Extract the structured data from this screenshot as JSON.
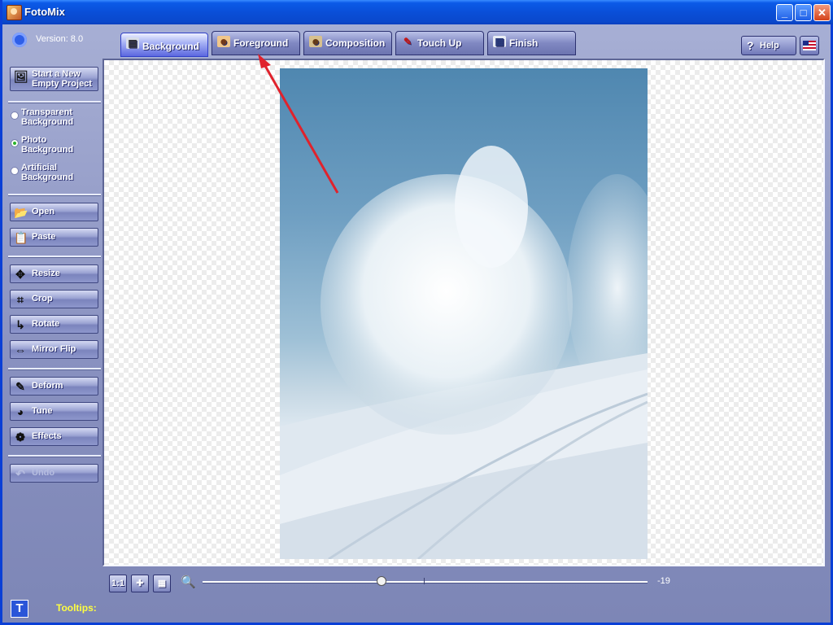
{
  "window": {
    "title": "FotoMix",
    "controls": {
      "minimize": "_",
      "maximize": "□",
      "close": "✕"
    }
  },
  "sidebar": {
    "version": "Version: 8.0",
    "new_project": {
      "line1": "Start a New",
      "line2": "Empty Project",
      "icon": "new-project-icon"
    },
    "background_options": [
      {
        "line1": "Transparent",
        "line2": "Background",
        "checked": false
      },
      {
        "line1": "Photo",
        "line2": "Background",
        "checked": true
      },
      {
        "line1": "Artificial",
        "line2": "Background",
        "checked": false
      }
    ],
    "buttons": [
      {
        "label": "Open",
        "icon": "open-folder-icon",
        "glyph": "📂"
      },
      {
        "label": "Paste",
        "icon": "paste-icon",
        "glyph": "📋"
      },
      {
        "label": "Resize",
        "icon": "resize-move-icon",
        "glyph": "✥"
      },
      {
        "label": "Crop",
        "icon": "crop-icon",
        "glyph": "⌗"
      },
      {
        "label": "Rotate",
        "icon": "rotate-icon",
        "glyph": "↳"
      },
      {
        "label": "Mirror Flip",
        "icon": "mirror-flip-icon",
        "glyph": "⇔"
      },
      {
        "label": "Deform",
        "icon": "deform-icon",
        "glyph": "✎"
      },
      {
        "label": "Tune",
        "icon": "tune-icon",
        "glyph": "◕"
      },
      {
        "label": "Effects",
        "icon": "effects-icon",
        "glyph": "❁"
      },
      {
        "label": "Undo",
        "icon": "undo-icon",
        "glyph": "↶",
        "disabled": true
      }
    ]
  },
  "tabs": [
    {
      "label": "Background",
      "icon": "background-tab-icon",
      "active": true
    },
    {
      "label": "Foreground",
      "icon": "foreground-tab-icon",
      "active": false
    },
    {
      "label": "Composition",
      "icon": "composition-tab-icon",
      "active": false
    },
    {
      "label": "Touch Up",
      "icon": "touch-up-tab-icon",
      "active": false
    },
    {
      "label": "Finish",
      "icon": "finish-tab-icon",
      "active": false
    }
  ],
  "header": {
    "help_label": "Help",
    "help_glyph": "?",
    "language_icon": "us-flag-icon"
  },
  "toolbar": {
    "actual_size_label": "1:1",
    "fit_glyph": "✚",
    "grid_glyph": "▦",
    "zoom_glyph": "🔍",
    "zoom_value": "-19",
    "zoom_value_number": -19
  },
  "footer": {
    "tooltips_button": "T",
    "tooltips_label": "Tooltips:"
  }
}
